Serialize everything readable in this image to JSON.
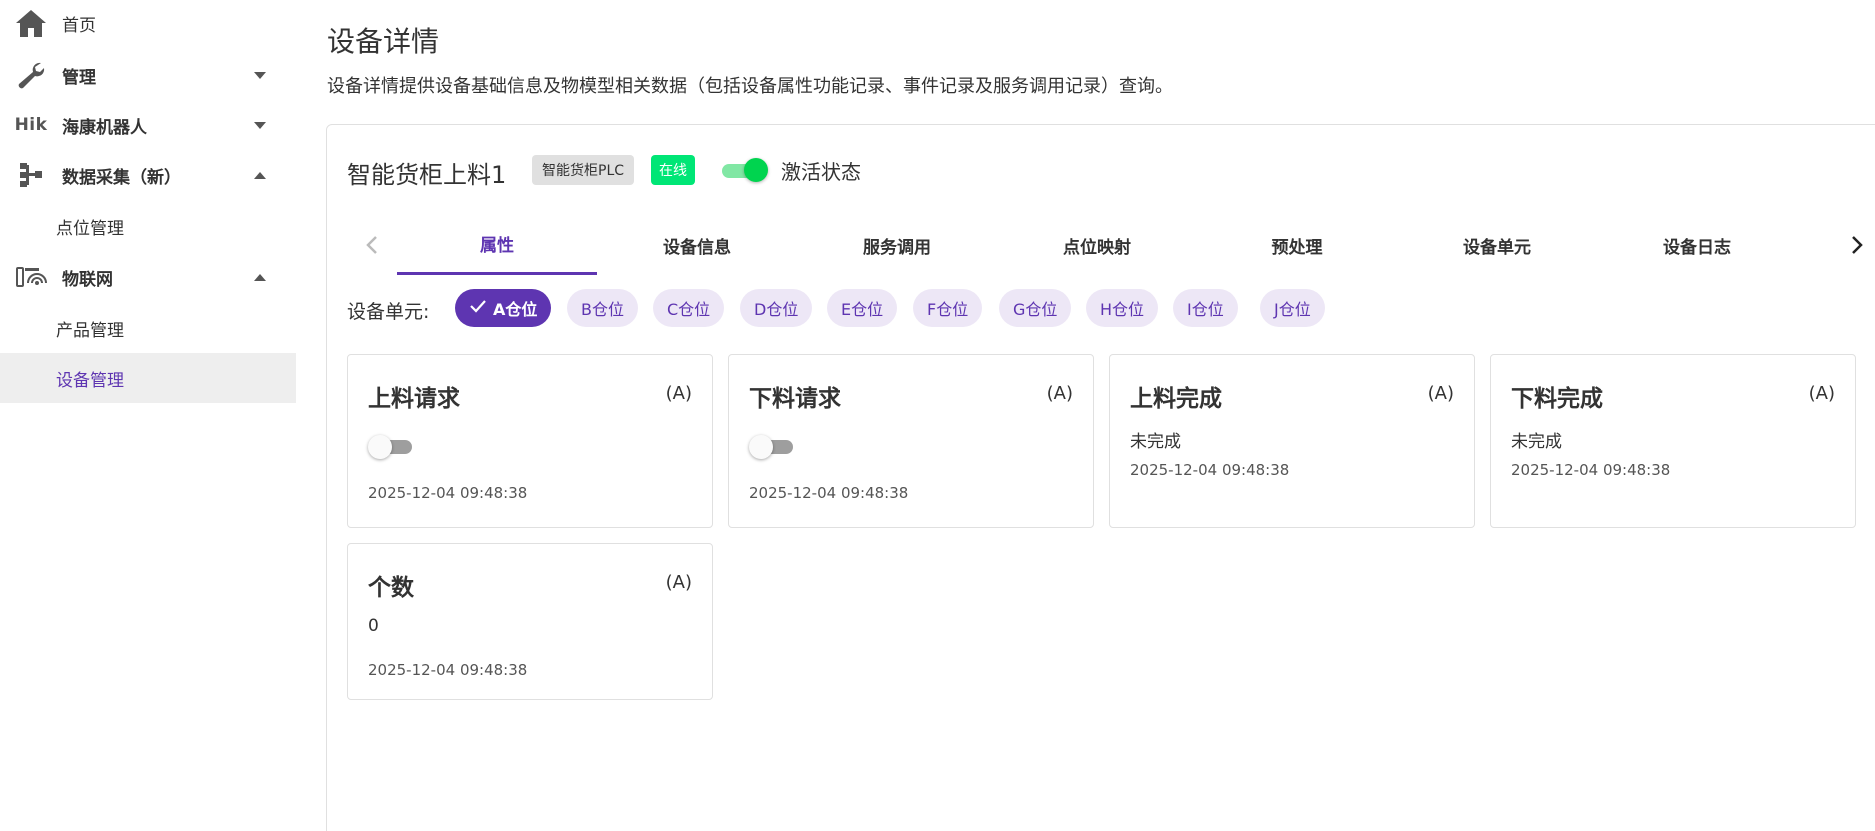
{
  "sidebar": {
    "items": [
      {
        "label": "首页",
        "icon": "home-icon"
      },
      {
        "label": "管理",
        "icon": "wrench-icon"
      },
      {
        "label": "海康机器人",
        "icon": "hik-logo",
        "logo_text": "Hik"
      },
      {
        "label": "数据采集（新）",
        "icon": "tree-icon"
      },
      {
        "label": "点位管理"
      },
      {
        "label": "物联网",
        "icon": "iot-icon"
      },
      {
        "label": "产品管理"
      },
      {
        "label": "设备管理"
      }
    ]
  },
  "page": {
    "title": "设备详情",
    "description": "设备详情提供设备基础信息及物模型相关数据（包括设备属性功能记录、事件记录及服务调用记录）查询。"
  },
  "device": {
    "name": "智能货柜上料1",
    "product_chip": "智能货柜PLC",
    "status_chip": "在线",
    "activate_label": "激活状态",
    "activated": true
  },
  "tabs": [
    "属性",
    "设备信息",
    "服务调用",
    "点位映射",
    "预处理",
    "设备单元",
    "设备日志"
  ],
  "active_tab": "属性",
  "units": {
    "label": "设备单元:",
    "chips": [
      "A仓位",
      "B仓位",
      "C仓位",
      "D仓位",
      "E仓位",
      "F仓位",
      "G仓位",
      "H仓位",
      "I仓位",
      "J仓位"
    ],
    "selected": "A仓位"
  },
  "properties": [
    {
      "title": "上料请求",
      "unit": "(A)",
      "type": "switch",
      "value": false,
      "time": "2025-12-04 09:48:38"
    },
    {
      "title": "下料请求",
      "unit": "(A)",
      "type": "switch",
      "value": false,
      "time": "2025-12-04 09:48:38"
    },
    {
      "title": "上料完成",
      "unit": "(A)",
      "type": "text",
      "value": "未完成",
      "time": "2025-12-04 09:48:38"
    },
    {
      "title": "下料完成",
      "unit": "(A)",
      "type": "text",
      "value": "未完成",
      "time": "2025-12-04 09:48:38"
    },
    {
      "title": "个数",
      "unit": "(A)",
      "type": "text",
      "value": "0",
      "time": "2025-12-04 09:48:38"
    }
  ],
  "colors": {
    "accent": "#5e35b1",
    "accent_light": "#ede7f6",
    "online": "#00e676",
    "toggle_on": "#00d44f"
  }
}
